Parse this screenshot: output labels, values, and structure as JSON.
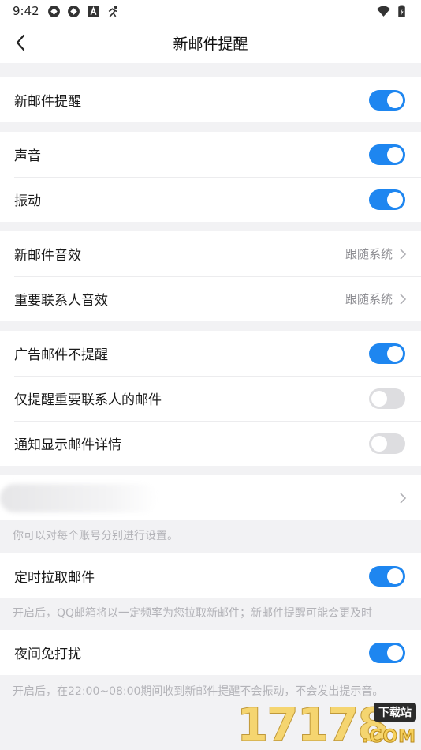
{
  "status_bar": {
    "time": "9:42",
    "left_icons": [
      "app-icon-1",
      "app-icon-2",
      "font-icon",
      "running-icon"
    ],
    "right_icons": [
      "wifi-icon",
      "battery-icon"
    ]
  },
  "nav": {
    "title": "新邮件提醒",
    "back_icon": "chevron-left-icon"
  },
  "sections": {
    "new_mail": {
      "label": "新邮件提醒",
      "on": true
    },
    "sound": {
      "label": "声音",
      "on": true
    },
    "vibration": {
      "label": "振动",
      "on": true
    },
    "new_mail_sound": {
      "label": "新邮件音效",
      "value": "跟随系统"
    },
    "vip_sound": {
      "label": "重要联系人音效",
      "value": "跟随系统"
    },
    "ad_no_remind": {
      "label": "广告邮件不提醒",
      "on": true
    },
    "vip_only": {
      "label": "仅提醒重要联系人的邮件",
      "on": false
    },
    "show_details": {
      "label": "通知显示邮件详情",
      "on": false
    },
    "account_note": "你可以对每个账号分别进行设置。",
    "scheduled_fetch": {
      "label": "定时拉取邮件",
      "on": true
    },
    "scheduled_note": "开启后，QQ邮箱将以一定频率为您拉取新邮件；新邮件提醒可能会更及时",
    "night_dnd": {
      "label": "夜间免打扰",
      "on": true
    },
    "night_note": "开启后，在22:00~08:00期间收到新邮件提醒不会振动，不会发出提示音。"
  },
  "watermark": {
    "number": "17178",
    "tag": "下载站",
    "domain": ".COM"
  },
  "colors": {
    "accent": "#1e86f0",
    "toggle_off": "#dddde0",
    "background": "#f2f2f4"
  }
}
